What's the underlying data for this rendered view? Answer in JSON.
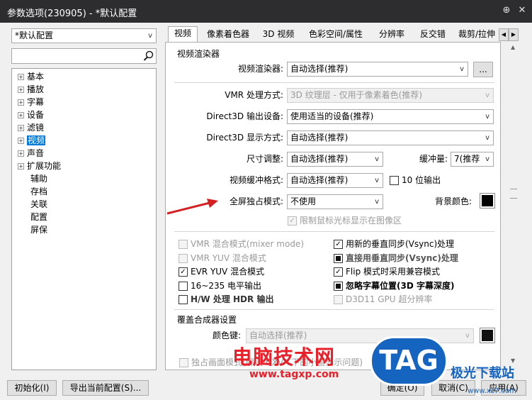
{
  "window": {
    "title": "参数选项(230905) - *默认配置",
    "pin": "⊕",
    "close": "✕"
  },
  "profile_combo": "*默认配置",
  "tree": [
    {
      "label": "基本",
      "exp": true
    },
    {
      "label": "播放",
      "exp": true
    },
    {
      "label": "字幕",
      "exp": true
    },
    {
      "label": "设备",
      "exp": true
    },
    {
      "label": "滤镜",
      "exp": true
    },
    {
      "label": "视频",
      "exp": true,
      "sel": true
    },
    {
      "label": "声音",
      "exp": true
    },
    {
      "label": "扩展功能",
      "exp": true
    },
    {
      "label": "辅助"
    },
    {
      "label": "存档"
    },
    {
      "label": "关联"
    },
    {
      "label": "配置"
    },
    {
      "label": "屏保"
    }
  ],
  "tabs": [
    "视频",
    "像素着色器",
    "3D 视频",
    "色彩空间/属性",
    "分辨率",
    "反交错",
    "裁剪/拉伸"
  ],
  "group1": "视频渲染器",
  "renderer": {
    "label": "视频渲染器:",
    "value": "自动选择(推荐)",
    "more": "..."
  },
  "vmr": {
    "label": "VMR 处理方式:",
    "value": "3D 纹理层 - 仅用于像素着色(推荐)"
  },
  "d3d_dev": {
    "label": "Direct3D 输出设备:",
    "value": "使用适当的设备(推荐)"
  },
  "d3d_mode": {
    "label": "Direct3D 显示方式:",
    "value": "自动选择(推荐)"
  },
  "resize": {
    "label": "尺寸调整:",
    "value": "自动选择(推荐)"
  },
  "buffer": {
    "label": "缓冲量:",
    "value": "7(推荐"
  },
  "buf_fmt": {
    "label": "视频缓冲格式:",
    "value": "自动选择(推荐)"
  },
  "tenbit": "10 位输出",
  "fullscreen": {
    "label": "全屏独占模式:",
    "value": "不使用"
  },
  "bg": "背景颜色:",
  "limit_cursor": "限制鼠标光标显示在图像区",
  "opts_left": [
    {
      "t": "VMR 混合模式(mixer mode)",
      "s": "dis"
    },
    {
      "t": "VMR YUV 混合模式",
      "s": "dis"
    },
    {
      "t": "EVR YUV 混合模式",
      "s": "on"
    },
    {
      "t": "16~235 电平输出",
      "s": "off"
    },
    {
      "t": "H/W 处理 HDR 输出",
      "s": "bold"
    }
  ],
  "opts_right": [
    {
      "t": "用新的垂直同步(Vsync)处理",
      "s": "on"
    },
    {
      "t": "直接用垂直同步(Vsync)处理",
      "s": "ind"
    },
    {
      "t": "Flip 模式时采用兼容模式",
      "s": "on"
    },
    {
      "t": "忽略字幕位置(3D 字幕深度)",
      "s": "indb"
    },
    {
      "t": "D3D11 GPU 超分辨率",
      "s": "dis"
    }
  ],
  "group2": "覆盖合成器设置",
  "colorkey": {
    "label": "颜色键:",
    "value": "自动选择(推荐)"
  },
  "exclusive": "独占画面模式(解决 DXVA 下的小窗显示问题)",
  "buttons": {
    "init": "初始化(I)",
    "export": "导出当前配置(S)...",
    "ok": "确定(O)",
    "cancel": "取消(C)",
    "apply": "应用(A)"
  },
  "watermark": {
    "main": "电脑技术网",
    "url": "www.tagxp.com",
    "tag": "TAG",
    "right": "极光下载站",
    "right_url": "www.xz7.com"
  },
  "colors": {
    "accent": "#0078d7",
    "titlebar": "#2d2d30",
    "arrow": "#d42020",
    "wm_red": "#e8202a",
    "wm_blue": "#1565c0"
  }
}
